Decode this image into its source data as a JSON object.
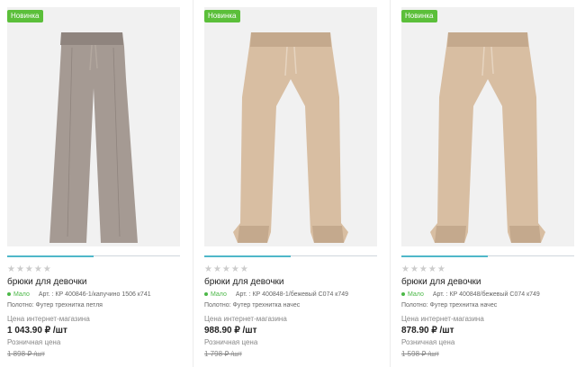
{
  "products": [
    {
      "badge": "Новинка",
      "stars": "★★★★★",
      "title": "брюки для девочки",
      "availability": "Мало",
      "article": "Арт. : КР 400846-1/капучино 1506 к741",
      "fabric": "Полотно: Футер трехнитка петля",
      "price_label": "Цена интернет-магазина",
      "price": "1 043.90 ₽ /шт",
      "retail_label": "Розничная цена",
      "retail_price": "1 898 ₽ /шт",
      "image_progress": 0.5,
      "colors": {
        "fabric": "#a59a93",
        "shade": "#8f847e",
        "cord": "#b3a89f"
      }
    },
    {
      "badge": "Новинка",
      "stars": "★★★★★",
      "title": "брюки для девочки",
      "availability": "Мало",
      "article": "Арт. : КР 400848-1/бежевый С074 к749",
      "fabric": "Полотно: Футер трехнитка начес",
      "price_label": "Цена интернет-магазина",
      "price": "988.90 ₽ /шт",
      "retail_label": "Розничная цена",
      "retail_price": "1 798 ₽ /шт",
      "image_progress": 0.5,
      "colors": {
        "fabric": "#d8bea2",
        "shade": "#c4a98d",
        "cord": "#e6d4c0"
      }
    },
    {
      "badge": "Новинка",
      "stars": "★★★★★",
      "title": "брюки для девочки",
      "availability": "Мало",
      "article": "Арт. : КР 400848/бежевый С074 к749",
      "fabric": "Полотно: Футер трехнитка начес",
      "price_label": "Цена интернет-магазина",
      "price": "878.90 ₽ /шт",
      "retail_label": "Розничная цена",
      "retail_price": "1 598 ₽ /шт",
      "image_progress": 0.5,
      "colors": {
        "fabric": "#d8bea2",
        "shade": "#c4a98d",
        "cord": "#e6d4c0"
      }
    }
  ],
  "accent_color": "#4fb7c9",
  "badge_color": "#5bbf3a"
}
